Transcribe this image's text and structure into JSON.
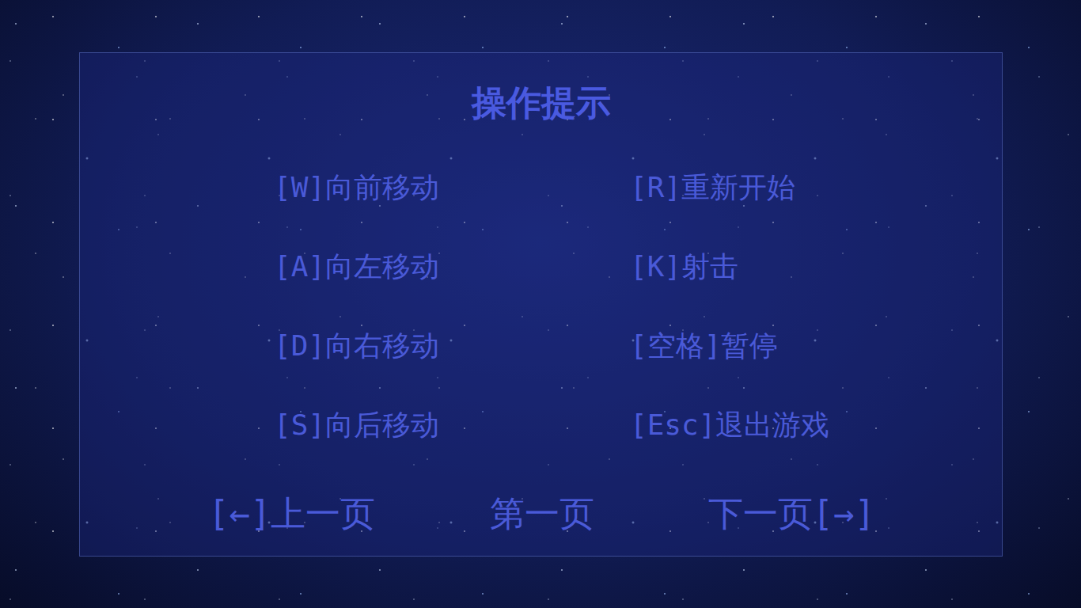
{
  "panel": {
    "title": "操作提示"
  },
  "controls": [
    {
      "label": "[W]向前移动"
    },
    {
      "label": "[R]重新开始"
    },
    {
      "label": "[A]向左移动"
    },
    {
      "label": "[K]射击"
    },
    {
      "label": "[D]向右移动"
    },
    {
      "label": "[空格]暂停"
    },
    {
      "label": "[S]向后移动"
    },
    {
      "label": "[Esc]退出游戏"
    }
  ],
  "pagination": {
    "previous": "[←]上一页",
    "current": "第一页",
    "next": "下一页[→]"
  }
}
